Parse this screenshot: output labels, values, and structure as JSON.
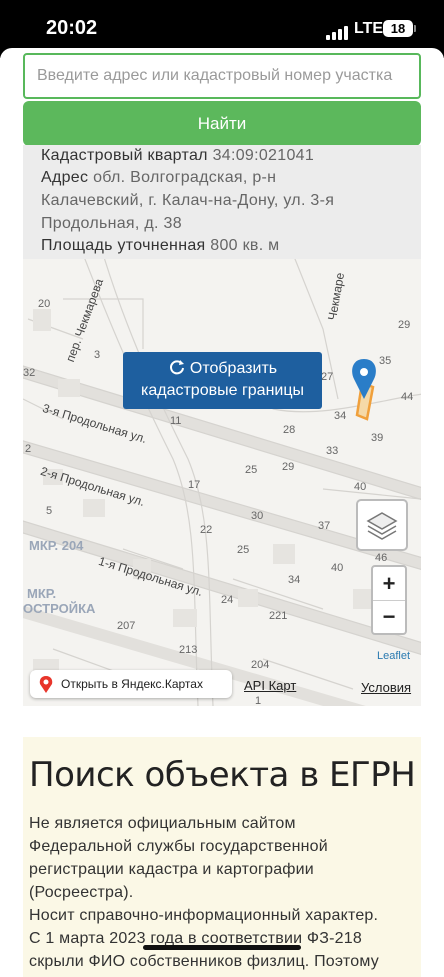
{
  "status_bar": {
    "time": "20:02",
    "network": "LTE",
    "battery": "18"
  },
  "search": {
    "placeholder": "Введите адрес или кадастровый номер участка"
  },
  "find_button": {
    "label": "Найти"
  },
  "info": {
    "quarter_label": "Кадастровый квартал",
    "quarter_value": "34:09:021041",
    "address_label": "Адрес",
    "address_value_1": "обл. Волгоградская, р-н",
    "address_value_2": "Калачевский, г. Калач-на-Дону, ул. 3-я",
    "address_value_3": "Продольная, д. 38",
    "area_label": "Площадь уточненная",
    "area_value": "800 кв. м"
  },
  "map": {
    "show_borders_line1": "Отобразить",
    "show_borders_line2": "кадастровые границы",
    "zoom_in": "+",
    "zoom_out": "−",
    "leaflet": "Leaflet",
    "yandex_button": "Открыть в Яндекс.Картах",
    "api_link": "API Карт",
    "terms_link": "Условия",
    "streets": {
      "chekmareva": "пер. Чекмарева",
      "chkmare": "Чекмаре",
      "prodolnaya3": "3-я Продольная ул.",
      "prodolnaya2": "2-я Продольная ул.",
      "prodolnaya1": "1-я Продольная ул."
    },
    "districts": {
      "mkr204": "МКР. 204",
      "mkr_stroika_1": "МКР.",
      "mkr_stroika_2": "ОСТРОЙКА"
    },
    "house_numbers": {
      "n20": "20",
      "n29": "29",
      "n35": "35",
      "n44": "44",
      "n3": "3",
      "n27": "27",
      "n34": "34",
      "n39": "39",
      "n11": "11",
      "n28": "28",
      "n33": "33",
      "n25a": "25",
      "n29b": "29",
      "n17": "17",
      "n40a": "40",
      "n30": "30",
      "n37": "37",
      "n22": "22",
      "n25b": "25",
      "n46": "46",
      "n40b": "40",
      "n34b": "34",
      "n24": "24",
      "n221": "221",
      "n207": "207",
      "n213": "213",
      "n204": "204",
      "n1": "1",
      "n5": "5",
      "n2": "2",
      "n32": "32"
    }
  },
  "egrn": {
    "heading": "Поиск объекта в ЕГРН",
    "para1_line1": "Не является официальным сайтом",
    "para1_line2": "Федеральной службы государственной",
    "para1_line3": "регистрации кадастра и картографии",
    "para1_line4": "(Росреестра).",
    "para2_line1": "Носит справочно-информационный характер.",
    "para2_line2": "С 1 марта 2023 года в соответствии ФЗ-218",
    "para2_line3": "скрыли ФИО собственников физлиц. Поэтому"
  },
  "colors": {
    "accent_green": "#5cb85c",
    "map_button_blue": "#1e5f9f",
    "parcel_orange": "#f0a03c",
    "marker_blue": "#2a7dc8"
  }
}
